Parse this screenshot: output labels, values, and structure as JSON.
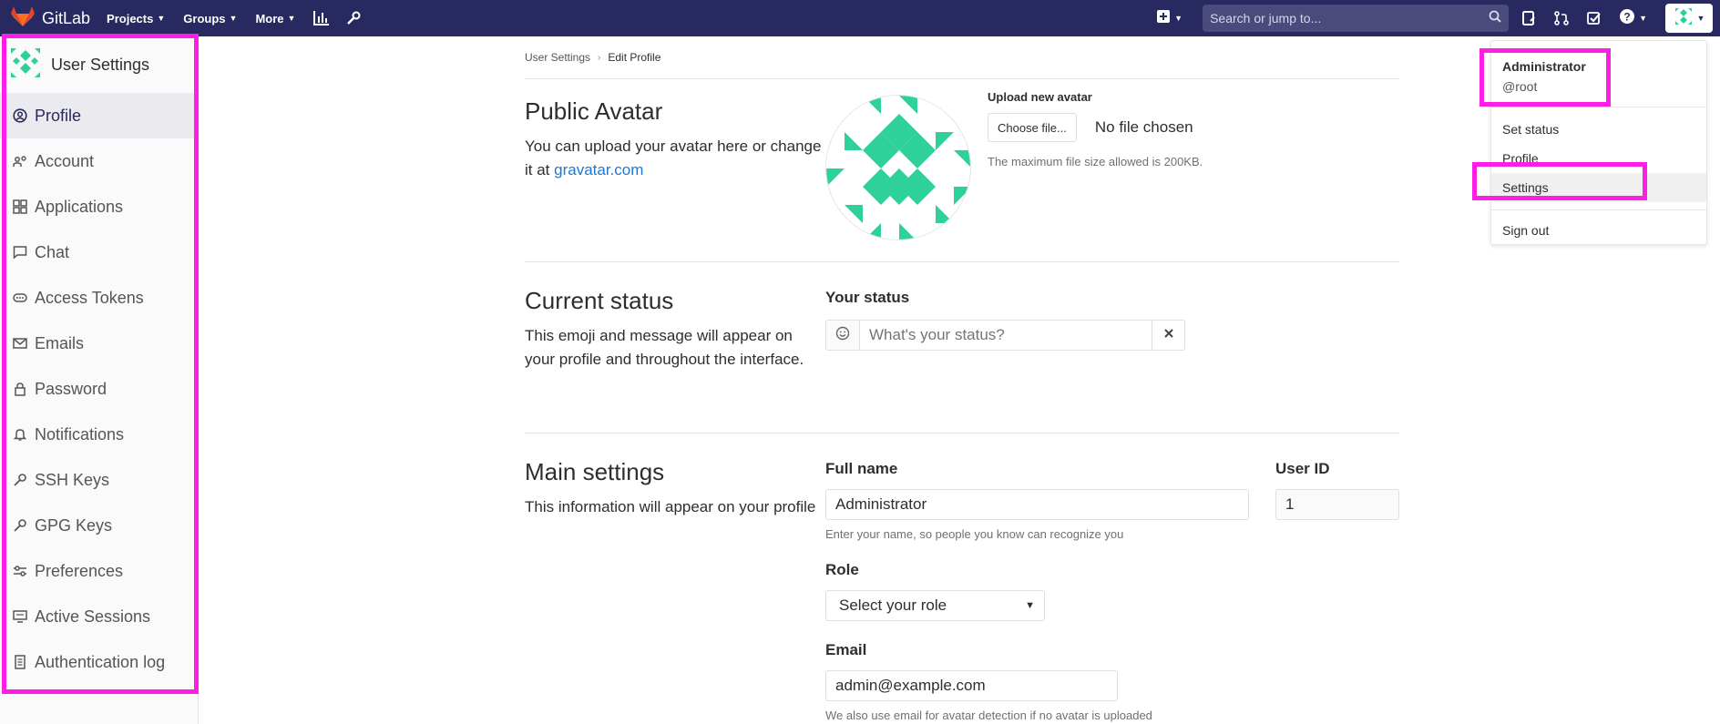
{
  "topnav": {
    "brand": "GitLab",
    "links": [
      {
        "label": "Projects"
      },
      {
        "label": "Groups"
      },
      {
        "label": "More"
      }
    ],
    "search_placeholder": "Search or jump to...",
    "colors": {
      "bg": "#292961",
      "search_bg": "#4a4a7d"
    }
  },
  "sidebar": {
    "title": "User Settings",
    "items": [
      {
        "label": "Profile",
        "icon": "profile-icon",
        "active": true
      },
      {
        "label": "Account",
        "icon": "account-icon"
      },
      {
        "label": "Applications",
        "icon": "applications-icon"
      },
      {
        "label": "Chat",
        "icon": "chat-icon"
      },
      {
        "label": "Access Tokens",
        "icon": "token-icon"
      },
      {
        "label": "Emails",
        "icon": "email-icon"
      },
      {
        "label": "Password",
        "icon": "lock-icon"
      },
      {
        "label": "Notifications",
        "icon": "bell-icon"
      },
      {
        "label": "SSH Keys",
        "icon": "key-icon"
      },
      {
        "label": "GPG Keys",
        "icon": "key-icon"
      },
      {
        "label": "Preferences",
        "icon": "preferences-icon"
      },
      {
        "label": "Active Sessions",
        "icon": "sessions-icon"
      },
      {
        "label": "Authentication log",
        "icon": "log-icon"
      }
    ]
  },
  "breadcrumb": {
    "parent": "User Settings",
    "current": "Edit Profile"
  },
  "avatar_section": {
    "title": "Public Avatar",
    "desc_prefix": "You can upload your avatar here or change it at ",
    "desc_link": "gravatar.com",
    "upload_label": "Upload new avatar",
    "choose_button": "Choose file...",
    "no_file": "No file chosen",
    "size_hint": "The maximum file size allowed is 200KB.",
    "avatar_color": "#2ed199"
  },
  "status_section": {
    "title": "Current status",
    "desc": "This emoji and message will appear on your profile and throughout the interface.",
    "field_label": "Your status",
    "placeholder": "What's your status?"
  },
  "main_section": {
    "title": "Main settings",
    "desc": "This information will appear on your profile",
    "full_name_label": "Full name",
    "full_name_value": "Administrator",
    "full_name_hint": "Enter your name, so people you know can recognize you",
    "user_id_label": "User ID",
    "user_id_value": "1",
    "role_label": "Role",
    "role_value": "Select your role",
    "email_label": "Email",
    "email_value": "admin@example.com",
    "email_hint": "We also use email for avatar detection if no avatar is uploaded"
  },
  "user_dropdown": {
    "name": "Administrator",
    "handle": "@root",
    "items": [
      "Set status",
      "Profile",
      "Settings",
      "Sign out"
    ]
  },
  "highlight_color": "#ff1ee6"
}
